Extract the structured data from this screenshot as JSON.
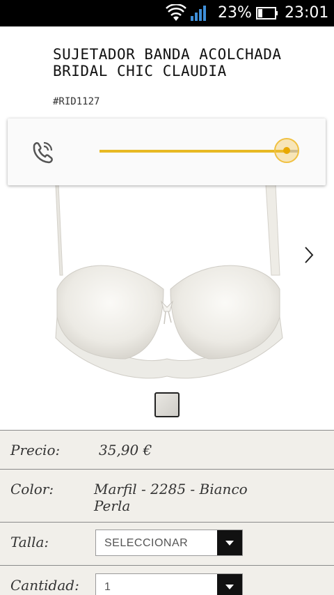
{
  "status_bar": {
    "battery_percent": "23%",
    "time": "23:01"
  },
  "product": {
    "title": "SUJETADOR BANDA ACOLCHADA BRIDAL CHIC CLAUDIA",
    "reference": "#RID1127"
  },
  "volume_popup": {
    "icon": "phone-in-call-icon",
    "level": 0.94,
    "accent_color": "#e8b923"
  },
  "details": {
    "price_label": "Precio:",
    "price_value": "35,90 €",
    "color_label": "Color:",
    "color_value": "Marfil - 2285 - Bianco Perla",
    "size_label": "Talla:",
    "size_select": "SELECCIONAR",
    "quantity_label": "Cantidad:",
    "quantity_select": "1"
  }
}
